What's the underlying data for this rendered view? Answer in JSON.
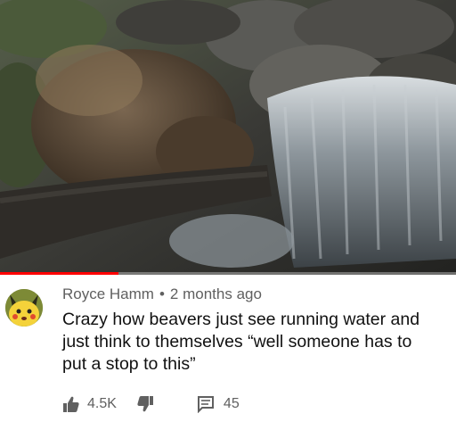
{
  "video": {
    "thumbnail_icon": "beaver-waterfall-frame",
    "progress_fraction": 0.26
  },
  "comment": {
    "avatar_icon": "pikachu-avatar",
    "author": "Royce Hamm",
    "separator": "•",
    "time": "2 months ago",
    "lines": [
      "Crazy how beavers just see running water and",
      "just think to themselves “well someone has to",
      "put a stop to this”"
    ],
    "likes": "4.5K",
    "replies": "45",
    "icons": {
      "like": "thumbs-up-icon",
      "dislike": "thumbs-down-icon",
      "reply": "comment-icon"
    }
  },
  "colors": {
    "meta_text": "#606060",
    "body_text": "#111111",
    "progress": "#ff0000"
  }
}
